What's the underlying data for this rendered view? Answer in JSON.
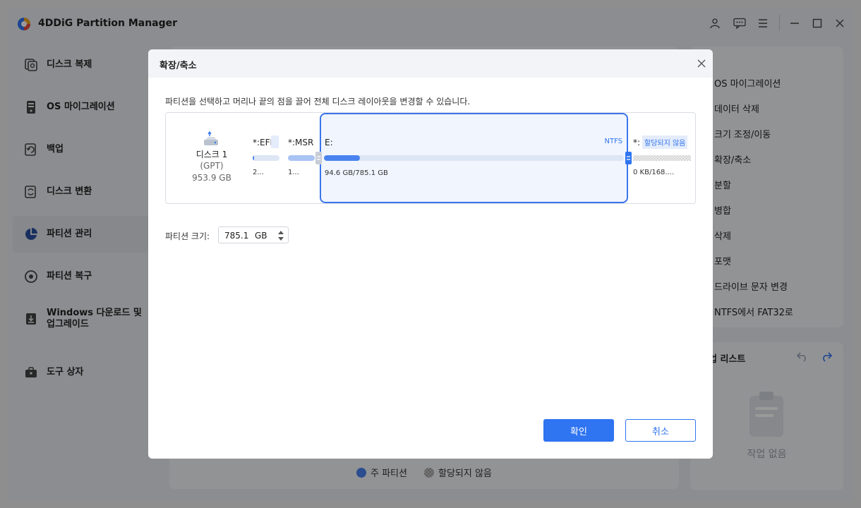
{
  "app": {
    "title": "4DDiG Partition Manager"
  },
  "sidebar": {
    "items": [
      {
        "label": "디스크 복제",
        "icon": "disk-clone-icon"
      },
      {
        "label": "OS 마이그레이션",
        "icon": "os-migration-icon"
      },
      {
        "label": "백업",
        "icon": "backup-icon"
      },
      {
        "label": "디스크 변환",
        "icon": "disk-convert-icon"
      },
      {
        "label": "파티션 관리",
        "icon": "pie-chart-icon",
        "active": true
      },
      {
        "label": "파티션 복구",
        "icon": "partition-recovery-icon"
      },
      {
        "label": "Windows 다운로드 및 업그레이드",
        "icon": "windows-download-icon"
      },
      {
        "label": "도구 상자",
        "icon": "toolbox-icon"
      }
    ]
  },
  "right_panel": {
    "items": [
      {
        "label": "OS 마이그레이션"
      },
      {
        "label": "데이터 삭제"
      },
      {
        "label": "크기 조정/이동"
      },
      {
        "label": "확장/축소"
      },
      {
        "label": "분할"
      },
      {
        "label": "병합"
      },
      {
        "label": "삭제"
      },
      {
        "label": "포맷"
      },
      {
        "label": "드라이브 문자 변경"
      },
      {
        "label": "NTFS에서 FAT32로"
      }
    ]
  },
  "operation_list": {
    "title": "작업 리스트",
    "empty": "작업 없음"
  },
  "legend": {
    "primary": "주 파티션",
    "unallocated": "할당되지 않음"
  },
  "dialog": {
    "title": "확장/축소",
    "description": "파티션을 선택하고 머리나 끝의 점을 끌어 전체 디스크 레이아웃을 변경할 수 있습니다.",
    "disk": {
      "name": "디스크 1",
      "type": "(GPT)",
      "size": "953.9 GB"
    },
    "partitions": [
      {
        "label": "*:EFI",
        "sub": "2...",
        "used_fraction": 0.05
      },
      {
        "label": "*:MSR",
        "sub": "1...",
        "used_fraction": 1.0
      },
      {
        "label": "E:",
        "fs": "NTFS",
        "sub": "94.6 GB/785.1 GB",
        "used_fraction": 0.12
      },
      {
        "label": "*:",
        "tag": "할당되지 않음",
        "sub": "0 KB/168...."
      }
    ],
    "size_field": {
      "label": "파티션 크기:",
      "value": "785.1",
      "unit": "GB"
    },
    "ok_label": "확인",
    "cancel_label": "취소"
  },
  "colors": {
    "accent": "#2f74f0",
    "bar_fill": "#4a83ef",
    "bar_bg": "#dde6f5",
    "selection_border": "#3b75ec"
  }
}
